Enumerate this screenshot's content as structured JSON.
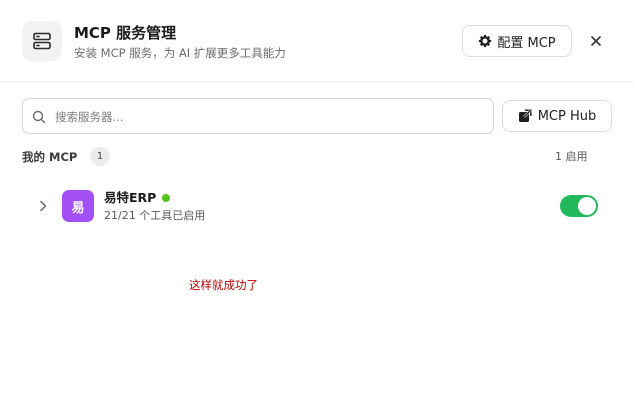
{
  "header": {
    "title": "MCP 服务管理",
    "subtitle": "安装 MCP 服务，为 AI 扩展更多工具能力",
    "icon": "server-icon",
    "config_label": "配置 MCP",
    "config_icon": "gear-icon",
    "close_icon": "close-icon"
  },
  "search": {
    "placeholder": "搜索服务器...",
    "value": "",
    "icon": "search-icon"
  },
  "hub_button": {
    "label": "MCP Hub",
    "icon": "external-link-icon"
  },
  "my_mcp": {
    "title": "我的 MCP",
    "count": "1",
    "enabled_text": "1 启用"
  },
  "servers": [
    {
      "avatar_text": "易",
      "name": "易特ERP",
      "tools_text": "21/21 个工具已启用",
      "status": "online",
      "enabled": true,
      "expand_icon": "chevron-right-icon"
    }
  ],
  "annotation": "这样就成功了",
  "colors": {
    "avatar_bg": "#a24ff5",
    "status_online": "#52c41a",
    "toggle_on": "#22b85c",
    "annotation": "#c00000"
  }
}
